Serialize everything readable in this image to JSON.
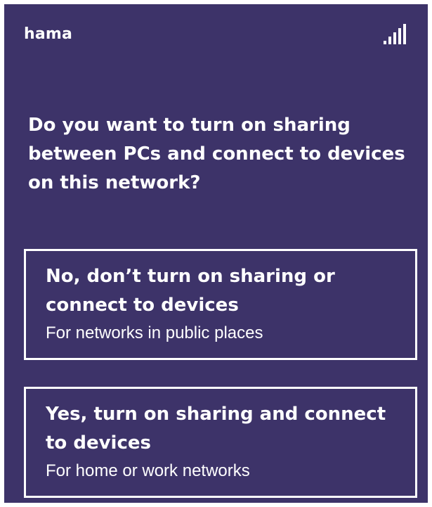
{
  "network": {
    "name": "hama",
    "signal_icon": "wifi-signal-bars-icon",
    "signal_level": 5
  },
  "prompt": {
    "question": "Do you want to turn on sharing between PCs and connect to devices on this network?"
  },
  "options": [
    {
      "title": "No, don’t turn on sharing or connect to devices",
      "subtitle": "For networks in public places"
    },
    {
      "title": "Yes, turn on sharing and connect to devices",
      "subtitle": "For home or work networks"
    }
  ],
  "colors": {
    "background": "#3d3369",
    "text": "#ffffff",
    "border": "#ffffff"
  }
}
